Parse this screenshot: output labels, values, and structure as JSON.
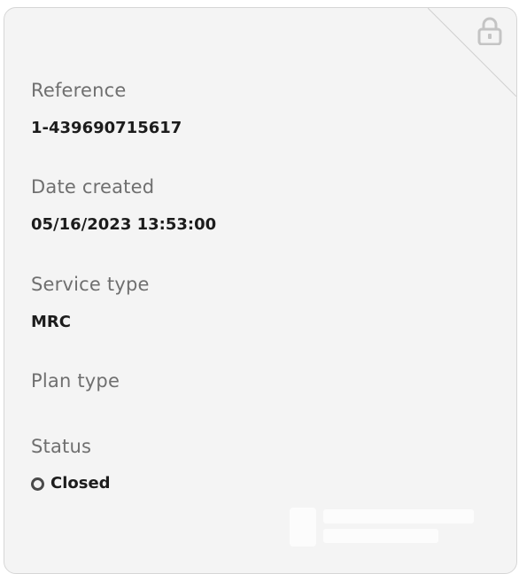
{
  "fields": [
    {
      "label": "Reference",
      "value": "1-439690715617"
    },
    {
      "label": "Date created",
      "value": "05/16/2023 13:53:00"
    },
    {
      "label": "Service type",
      "value": "MRC"
    },
    {
      "label": "Plan type",
      "value": ""
    },
    {
      "label": "Status",
      "value": "Closed"
    }
  ],
  "icons": {
    "lock": "lock-icon",
    "status": "status-ring-icon"
  },
  "colors": {
    "card_background": "#f4f4f4",
    "label": "#6f6f6f",
    "value": "#1c1c1c",
    "icon": "#c4c4c4"
  }
}
